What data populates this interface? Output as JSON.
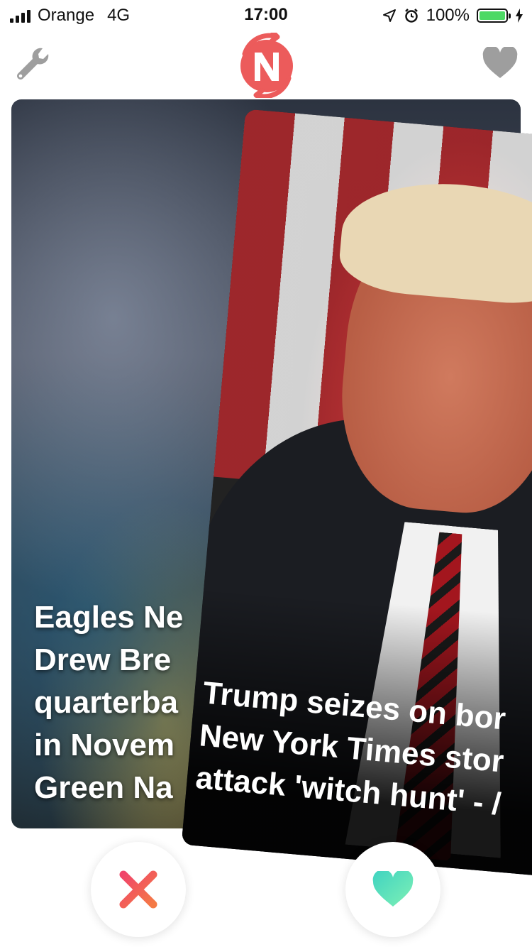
{
  "status_bar": {
    "carrier": "Orange",
    "network": "4G",
    "time": "17:00",
    "battery": "100%"
  },
  "nav": {
    "settings_icon": "wrench-icon",
    "logo_icon": "app-logo-icon",
    "favorites_icon": "heart-icon"
  },
  "cards": {
    "back": {
      "headline_lines": [
        "Eagles Ne",
        "Drew Bre",
        "quarterba",
        "in Novem",
        "Green Na"
      ]
    },
    "front": {
      "headline_lines": [
        "Trump seizes on bor",
        "New York Times stor",
        "attack 'witch hunt' - /"
      ]
    }
  },
  "actions": {
    "dislike_icon": "x-icon",
    "like_icon": "heart-icon"
  },
  "colors": {
    "accent_red": "#ec5b5b",
    "like_green": "#5ee0bd",
    "dislike_gradient": [
      "#f0446a",
      "#f47a45"
    ],
    "battery_green": "#4cd964",
    "nav_gray": "#9e9e9e"
  }
}
